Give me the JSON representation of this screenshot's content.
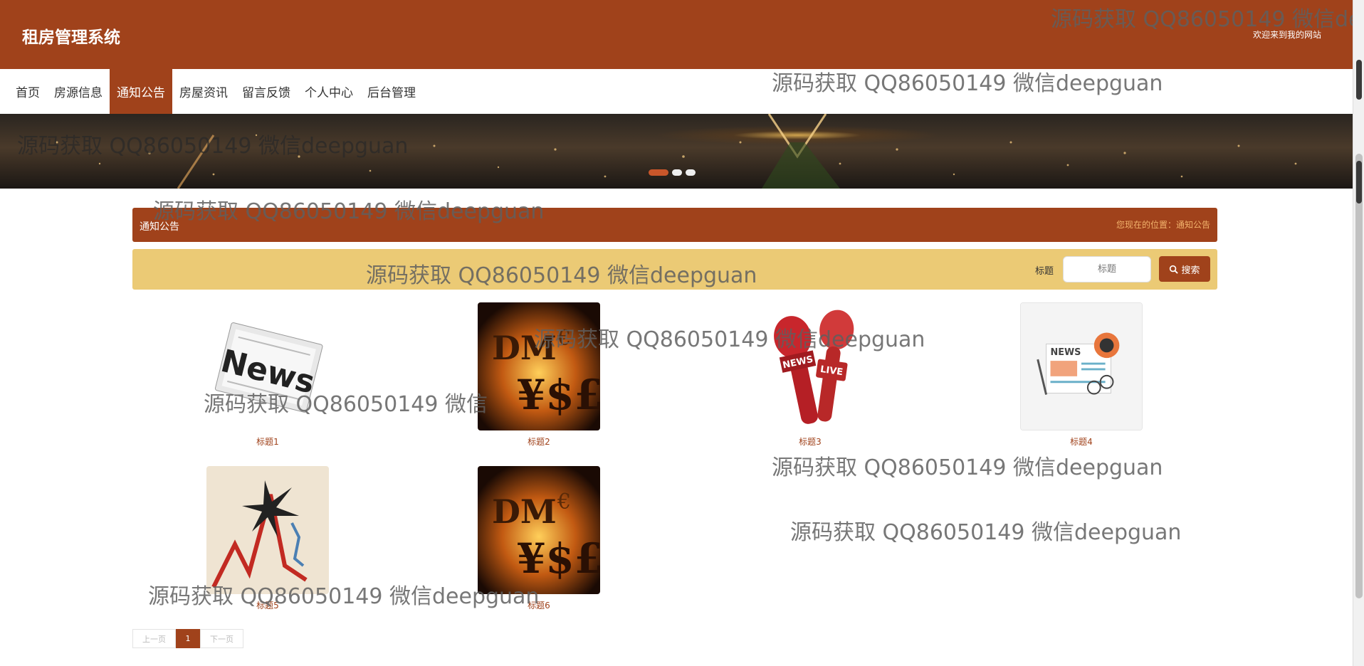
{
  "header": {
    "site_title": "租房管理系统",
    "welcome": "欢迎来到我的网站"
  },
  "nav": {
    "items": [
      {
        "label": "首页"
      },
      {
        "label": "房源信息"
      },
      {
        "label": "通知公告"
      },
      {
        "label": "房屋资讯"
      },
      {
        "label": "留言反馈"
      },
      {
        "label": "个人中心"
      },
      {
        "label": "后台管理"
      }
    ],
    "active_index": 2
  },
  "banner": {
    "slide_count": 3,
    "active_slide": 1
  },
  "breadcrumb": {
    "title": "通知公告",
    "position": "您现在的位置：通知公告"
  },
  "search": {
    "label": "标题",
    "placeholder": "标题",
    "button_label": "搜索"
  },
  "cards": [
    {
      "title": "标题1",
      "image": "news-paper-icon"
    },
    {
      "title": "标题2",
      "image": "currency-symbols-image"
    },
    {
      "title": "标题3",
      "image": "live-microphones-icon"
    },
    {
      "title": "标题4",
      "image": "news-illustration-icon"
    },
    {
      "title": "标题5",
      "image": "stock-crash-chart-image"
    },
    {
      "title": "标题6",
      "image": "currency-symbols-image"
    }
  ],
  "pagination": {
    "prev": "上一页",
    "current": "1",
    "next": "下一页"
  },
  "watermark": {
    "text": "源码获取 QQ86050149 微信deepguan",
    "text_partial_1": "源码获取 QQ86050149 微信dee",
    "text_partial_2": "源码获取 QQ86050149 微信"
  },
  "colors": {
    "primary": "#a0421b",
    "search_bar": "#ebca75",
    "breadcrumb_text": "#f2b36c"
  }
}
